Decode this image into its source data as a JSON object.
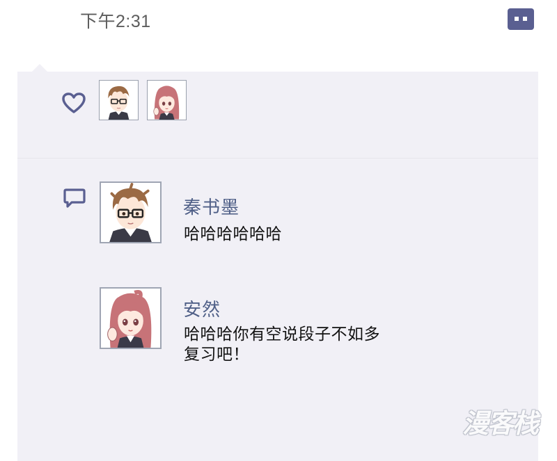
{
  "status": {
    "time": "下午2:31"
  },
  "header": {
    "comment_icon": "comment-bubble-icon"
  },
  "likes": {
    "icon": "heart-outline-icon",
    "users": [
      {
        "avatar": "boy-glasses-avatar"
      },
      {
        "avatar": "girl-pink-hair-avatar"
      }
    ]
  },
  "comments": {
    "icon": "speech-bubble-icon",
    "items": [
      {
        "name": "秦书墨",
        "lines": [
          "哈哈哈哈哈哈"
        ],
        "avatar": "boy-glasses-avatar"
      },
      {
        "name": "安然",
        "lines": [
          "哈哈哈你有空说段子不如多",
          "复习吧！"
        ],
        "avatar": "girl-pink-hair-avatar"
      }
    ]
  },
  "watermark": {
    "text": "漫客栈"
  },
  "colors": {
    "panel_bg": "#f1f0f6",
    "accent": "#5a5f91",
    "name_color": "#4f5f87",
    "timestamp": "#5d5d5d"
  }
}
